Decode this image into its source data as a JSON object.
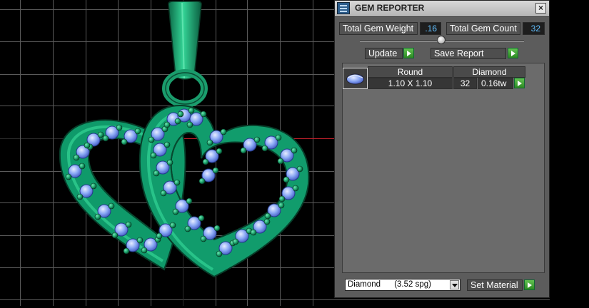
{
  "panel": {
    "title": "GEM REPORTER",
    "title_icon": "gem-reporter-icon",
    "close_icon": "close-icon",
    "total_gem_weight_label": "Total Gem Weight",
    "total_gem_weight_value": ".16",
    "total_gem_count_label": "Total Gem Count",
    "total_gem_count_value": "32",
    "update_label": "Update",
    "save_report_label": "Save Report",
    "gem_table": {
      "thumbnail_icon": "round-gem-icon",
      "shape": "Round",
      "material": "Diamond",
      "size": "1.10 X 1.10",
      "count": "32",
      "weight": "0.16tw"
    },
    "material_select_value": "Diamond      (3.52 spg)",
    "set_material_label": "Set Material"
  },
  "colors": {
    "viewport_bg": "#000000",
    "grid": "#5a5a5a",
    "metal": "#1c9c70",
    "gem": "#8aa8f5",
    "accent_value": "#62c0ff",
    "play_button": "#3aa52c"
  }
}
